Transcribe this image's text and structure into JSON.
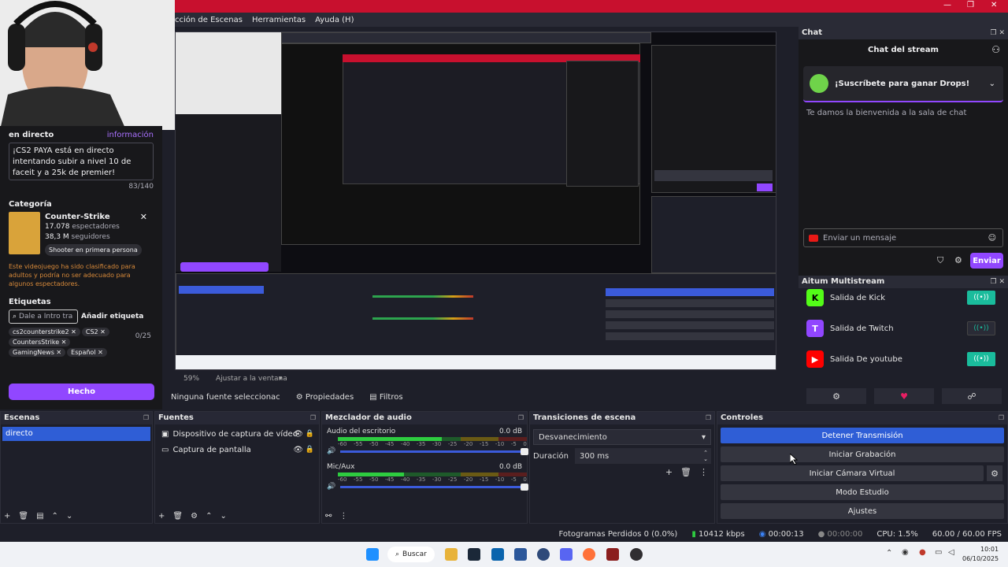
{
  "menu": [
    "cción de Escenas",
    "Herramientas",
    "Ayuda (H)"
  ],
  "window_controls": [
    "—",
    "❐",
    "✕"
  ],
  "twitch_panel": {
    "live_label": "en directo",
    "info_link": "información",
    "stream_title": "¡CS2 PAYA está en directo intentando subir a nivel 10 de faceit y a 25k de premier!",
    "char_count": "83/140",
    "category_label": "Categoría",
    "category_name": "Counter-Strike",
    "viewers_value": "17.078",
    "viewers_label": "espectadores",
    "followers_value": "38,3 M",
    "followers_label": "seguidores",
    "category_tag": "Shooter en primera persona",
    "mature_warning": "Este videojuego ha sido clasificado para adultos y podría no ser adecuado para algunos espectadores.",
    "tags_label": "Etiquetas",
    "tag_input_placeholder": "Dale a Intro tra",
    "add_tag_button": "Añadir etiqueta",
    "tag_count": "0/25",
    "tags": [
      "cs2counterstrike2",
      "CS2",
      "CountersStrike",
      "GamingNews",
      "Español"
    ],
    "done_button": "Hecho"
  },
  "preview": {
    "zoom": "59%",
    "zoom_fit": "Ajustar a la ventana",
    "no_source": "Ninguna fuente seleccionac",
    "properties": "Propiedades",
    "filters": "Filtros"
  },
  "chat": {
    "dock_title": "Chat",
    "stream_chat_title": "Chat del stream",
    "drops_banner": "¡Suscríbete para ganar Drops!",
    "welcome": "Te damos la bienvenida a la sala de chat",
    "input_placeholder": "Enviar un mensaje",
    "send_button": "Enviar"
  },
  "multistream": {
    "dock_title": "Aitum Multistream",
    "outputs": [
      {
        "name": "Salida de Kick",
        "logo": "K",
        "color": "#53fc18",
        "active": true
      },
      {
        "name": "Salida de Twitch",
        "logo": "T",
        "color": "#9146ff",
        "active": false
      },
      {
        "name": "Salida De youtube",
        "logo": "▶",
        "color": "#ff0000",
        "active": true
      }
    ],
    "toggle_label": "((•))"
  },
  "scenes": {
    "title": "Escenas",
    "items": [
      "directo"
    ]
  },
  "sources": {
    "title": "Fuentes",
    "items": [
      "Dispositivo de captura de vídeo",
      "Captura de pantalla"
    ]
  },
  "mixer": {
    "title": "Mezclador de audio",
    "channels": [
      {
        "name": "Audio del escritorio",
        "db": "0.0 dB",
        "level": 0.55
      },
      {
        "name": "Mic/Aux",
        "db": "0.0 dB",
        "level": 0.35
      }
    ],
    "scale": [
      "-60",
      "-55",
      "-50",
      "-45",
      "-40",
      "-35",
      "-30",
      "-25",
      "-20",
      "-15",
      "-10",
      "-5",
      "0"
    ]
  },
  "transitions": {
    "title": "Transiciones de escena",
    "selected": "Desvanecimiento",
    "duration_label": "Duración",
    "duration_value": "300 ms"
  },
  "controls": {
    "title": "Controles",
    "buttons": [
      "Detener Transmisión",
      "Iniciar Grabación",
      "Iniciar Cámara Virtual",
      "Modo Estudio",
      "Ajustes"
    ]
  },
  "status": {
    "dropped_frames": "Fotogramas Perdidos 0 (0.0%)",
    "bitrate": "10412 kbps",
    "stream_time": "00:00:13",
    "rec_time": "00:00:00",
    "cpu": "CPU: 1.5%",
    "fps": "60.00 / 60.00 FPS"
  },
  "taskbar": {
    "search": "Buscar",
    "time": "10:01",
    "date": "06/10/2025"
  },
  "colors": {
    "accent_blue": "#2f5ed6",
    "twitch_purple": "#9147ff",
    "title_red": "#c8102e"
  }
}
